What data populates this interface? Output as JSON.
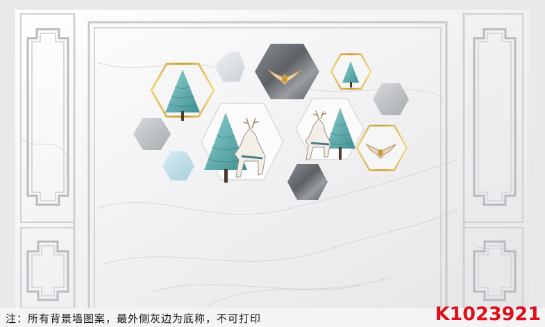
{
  "caption": {
    "note_text": "注：所有背景墙图案，最外侧灰边为底称，不可打印",
    "product_code": "K1023921"
  },
  "artwork": {
    "icons": [
      "tree-icon",
      "deer-icon",
      "bird-icon",
      "marble-hexagon-icon",
      "fret-frame-icon"
    ]
  },
  "colors": {
    "background": "#e9e9ec",
    "marble": "#f3f3f4",
    "gold": "#d9b540",
    "teal": "#6fb7b8",
    "slate": "#6e7175",
    "code_red": "#e0101a"
  }
}
